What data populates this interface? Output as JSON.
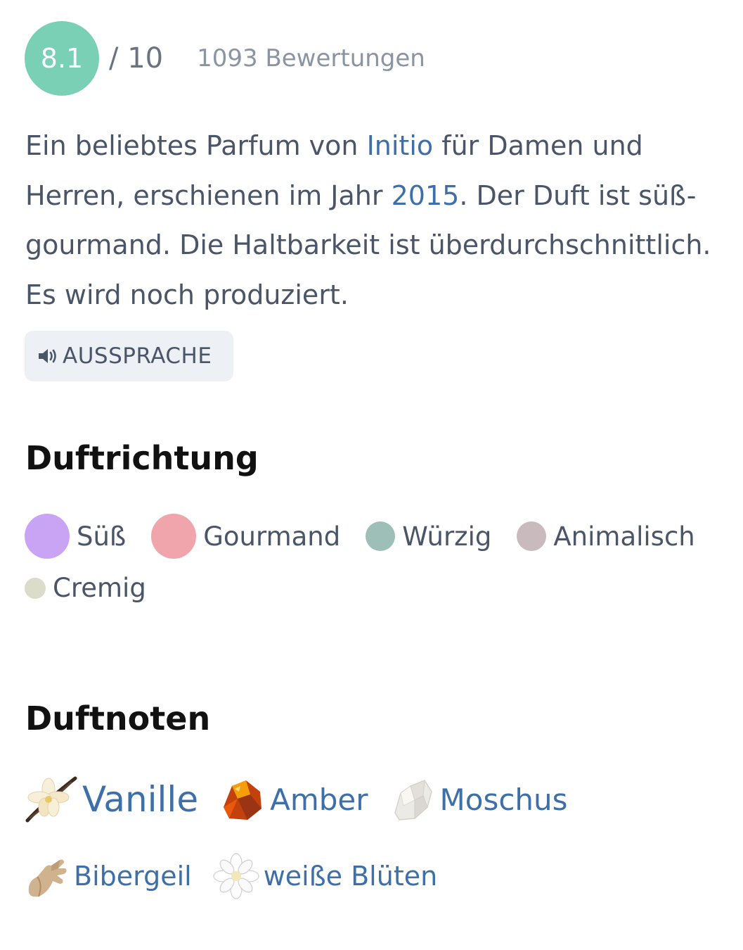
{
  "rating": {
    "score": "8.1",
    "scale": "/ 10",
    "count": "1093 Bewertungen"
  },
  "description": {
    "part1": "Ein beliebtes Parfum von ",
    "brand_link": "Initio",
    "part2": " für Damen und Herren, erschienen im Jahr ",
    "year_link": "2015",
    "part3": ". Der Duft ist süß-gourmand. Die Haltbarkeit ist überdurchschnittlich. Es wird noch produziert."
  },
  "pronunciation_button": {
    "label": "AUSSPRACHE",
    "icon": "speaker-icon"
  },
  "accords_section": {
    "title": "Duftrichtung",
    "accords": [
      {
        "label": "Süß",
        "color": "#c9a4f5",
        "strength": 1.0
      },
      {
        "label": "Gourmand",
        "color": "#f0a4ab",
        "strength": 1.0
      },
      {
        "label": "Würzig",
        "color": "#9dbfb8",
        "strength": 0.65
      },
      {
        "label": "Animalisch",
        "color": "#c9babd",
        "strength": 0.65
      },
      {
        "label": "Cremig",
        "color": "#dcdccb",
        "strength": 0.45
      }
    ]
  },
  "notes_section": {
    "title": "Duftnoten",
    "notes": [
      {
        "label": "Vanille",
        "icon": "vanilla-icon"
      },
      {
        "label": "Amber",
        "icon": "amber-icon"
      },
      {
        "label": "Moschus",
        "icon": "musk-icon"
      },
      {
        "label": "Bibergeil",
        "icon": "castoreum-icon"
      },
      {
        "label": "weiße Blüten",
        "icon": "white-flower-icon"
      }
    ]
  }
}
